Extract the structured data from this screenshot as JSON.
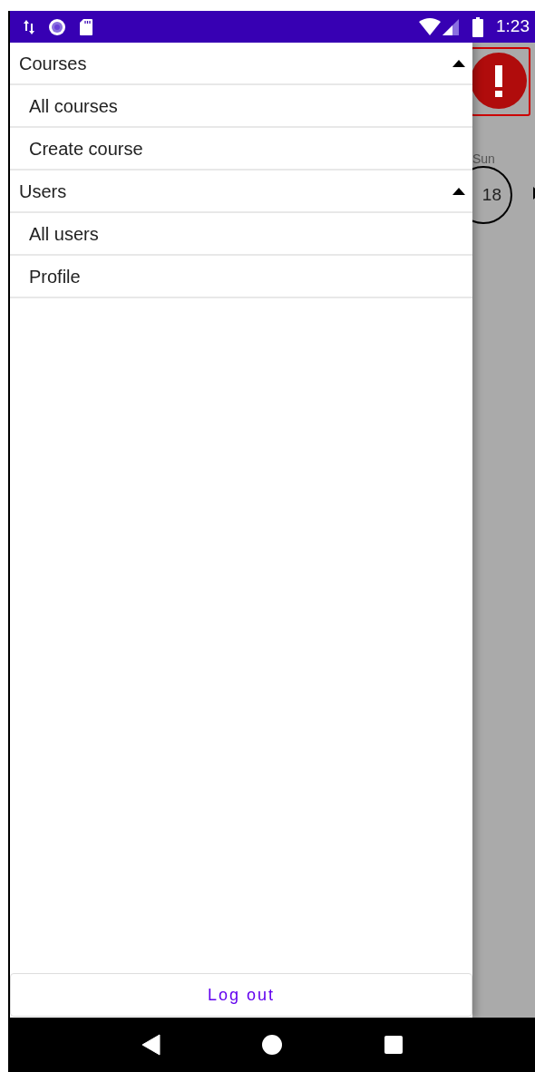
{
  "status_bar": {
    "time": "1:23"
  },
  "menu": [
    {
      "label": "Courses",
      "expanded": true,
      "children": [
        {
          "label": "All courses"
        },
        {
          "label": "Create course"
        }
      ]
    },
    {
      "label": "Users",
      "expanded": true,
      "children": [
        {
          "label": "All users"
        },
        {
          "label": "Profile"
        }
      ]
    }
  ],
  "logout_button": "Log out",
  "background": {
    "day": "Sun",
    "date": "18"
  }
}
